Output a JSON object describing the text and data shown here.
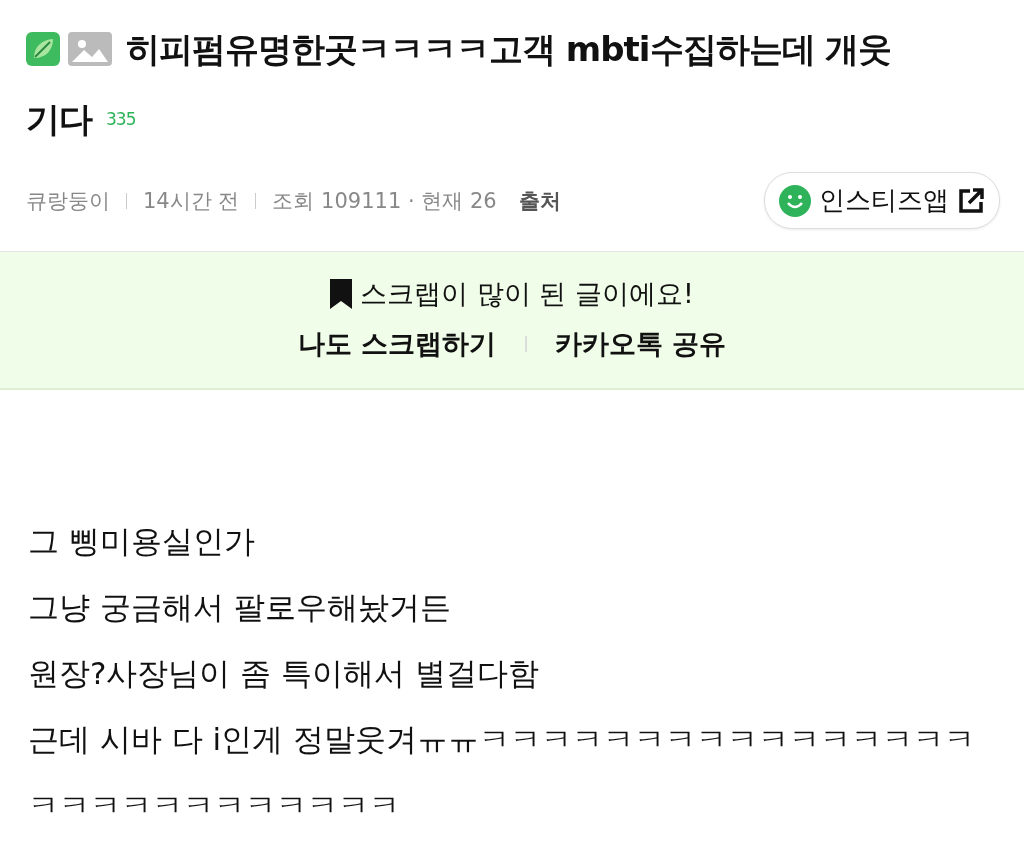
{
  "post": {
    "title_lines": [
      "히피펌유명한곳ㅋㅋㅋㅋ고객 mbti수집하는데 개웃",
      "기다"
    ],
    "comment_count": "335",
    "meta": {
      "author": "큐랑둥이",
      "time": "14시간 전",
      "views": "조회 109111 · 현재 26",
      "source": "출처"
    },
    "app_button": "인스티즈앱"
  },
  "scrap_banner": {
    "message": "스크랩이 많이 된 글이에요!",
    "actions": [
      "나도 스크랩하기",
      "카카오톡 공유"
    ]
  },
  "body": {
    "lines": [
      "그 삥미용실인가",
      "그냥 궁금해서 팔로우해놨거든",
      "원장?사장님이 좀 특이해서 별걸다함",
      "근데 시바 다 i인게 정말웃겨ㅠㅠㅋㅋㅋㅋㅋㅋㅋㅋㅋㅋㅋㅋㅋㅋㅋㅋㅋㅋㅋㅋㅋㅋㅋㅋㅋㅋㅋㅋ"
    ]
  }
}
